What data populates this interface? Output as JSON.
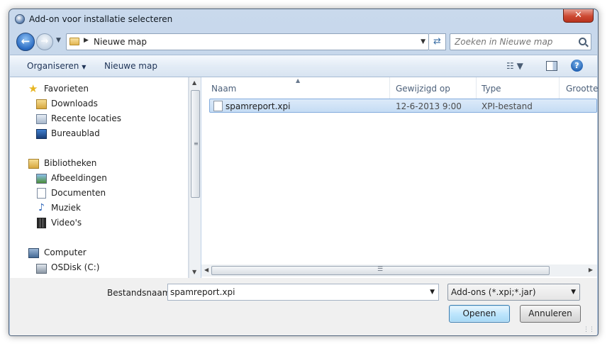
{
  "window": {
    "title": "Add-on voor installatie selecteren",
    "close_label": "✕"
  },
  "address": {
    "path": "Nieuwe map",
    "separator": "▶"
  },
  "search": {
    "placeholder": "Zoeken in Nieuwe map"
  },
  "toolbar": {
    "organise_label": "Organiseren",
    "organise_arrow": "▼",
    "new_folder_label": "Nieuwe map",
    "help_label": "?",
    "views_label": "☷ ▼"
  },
  "nav": {
    "favorites": {
      "label": "Favorieten",
      "items": [
        {
          "label": "Downloads",
          "icon": "downloads-folder-icon"
        },
        {
          "label": "Recente locaties",
          "icon": "recent-places-icon"
        },
        {
          "label": "Bureaublad",
          "icon": "desktop-icon"
        }
      ]
    },
    "libraries": {
      "label": "Bibliotheken",
      "items": [
        {
          "label": "Afbeeldingen",
          "icon": "pictures-icon"
        },
        {
          "label": "Documenten",
          "icon": "documents-icon"
        },
        {
          "label": "Muziek",
          "icon": "music-icon"
        },
        {
          "label": "Video's",
          "icon": "videos-icon"
        }
      ]
    },
    "computer": {
      "label": "Computer",
      "items": [
        {
          "label": "OSDisk (C:)",
          "icon": "disk-icon"
        }
      ]
    }
  },
  "files": {
    "columns": [
      "Naam",
      "Gewijzigd op",
      "Type",
      "Grootte"
    ],
    "rows": [
      {
        "name": "spamreport.xpi",
        "modified": "12-6-2013 9:00",
        "type": "XPI-bestand",
        "selected": true
      }
    ]
  },
  "bottom": {
    "filename_label": "Bestandsnaam:",
    "filename_value": "spamreport.xpi",
    "filter_value": "Add-ons (*.xpi;*.jar)",
    "open_label": "Openen",
    "cancel_label": "Annuleren"
  },
  "colors": {
    "window_frame": "#b9cde6",
    "selection": "#c5dcf4",
    "default_button": "#bee6fd"
  }
}
